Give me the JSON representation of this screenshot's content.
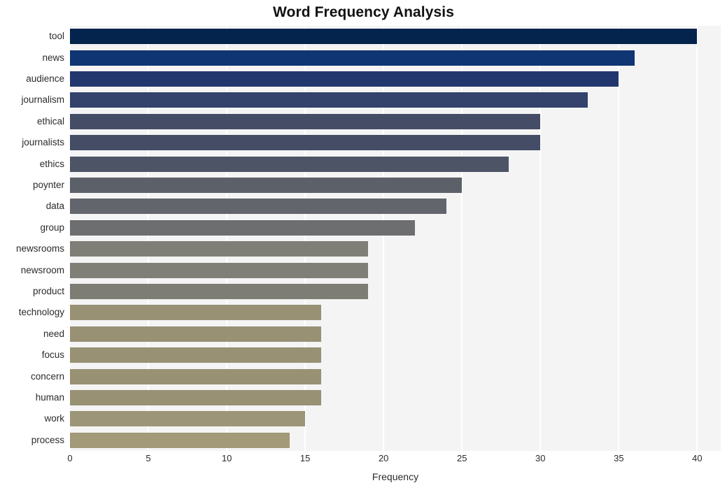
{
  "chart_data": {
    "type": "bar",
    "orientation": "horizontal",
    "title": "Word Frequency Analysis",
    "xlabel": "Frequency",
    "ylabel": "",
    "xlim": [
      0,
      41.5
    ],
    "xticks": [
      0,
      5,
      10,
      15,
      20,
      25,
      30,
      35,
      40
    ],
    "xtick_labels": [
      "0",
      "5",
      "10",
      "15",
      "20",
      "25",
      "30",
      "35",
      "40"
    ],
    "grid": "vertical",
    "legend": "none",
    "background": "#f4f4f5",
    "gridline_color": "#ffffff",
    "categories": [
      "tool",
      "news",
      "audience",
      "journalism",
      "ethical",
      "journalists",
      "ethics",
      "poynter",
      "data",
      "group",
      "newsrooms",
      "newsroom",
      "product",
      "technology",
      "need",
      "focus",
      "concern",
      "human",
      "work",
      "process"
    ],
    "values": [
      40,
      36,
      35,
      33,
      30,
      30,
      28,
      25,
      24,
      22,
      19,
      19,
      19,
      16,
      16,
      16,
      16,
      16,
      15,
      14
    ],
    "bar_colors": [
      "#04234d",
      "#0f3573",
      "#22376e",
      "#34436b",
      "#454c66",
      "#454c66",
      "#4d5466",
      "#5c6068",
      "#62656b",
      "#6c6e70",
      "#807f77",
      "#807f77",
      "#7e7d75",
      "#989174",
      "#989174",
      "#989174",
      "#989174",
      "#989174",
      "#9c9577",
      "#a29a78"
    ]
  },
  "axis": {
    "x_title": "Frequency"
  }
}
